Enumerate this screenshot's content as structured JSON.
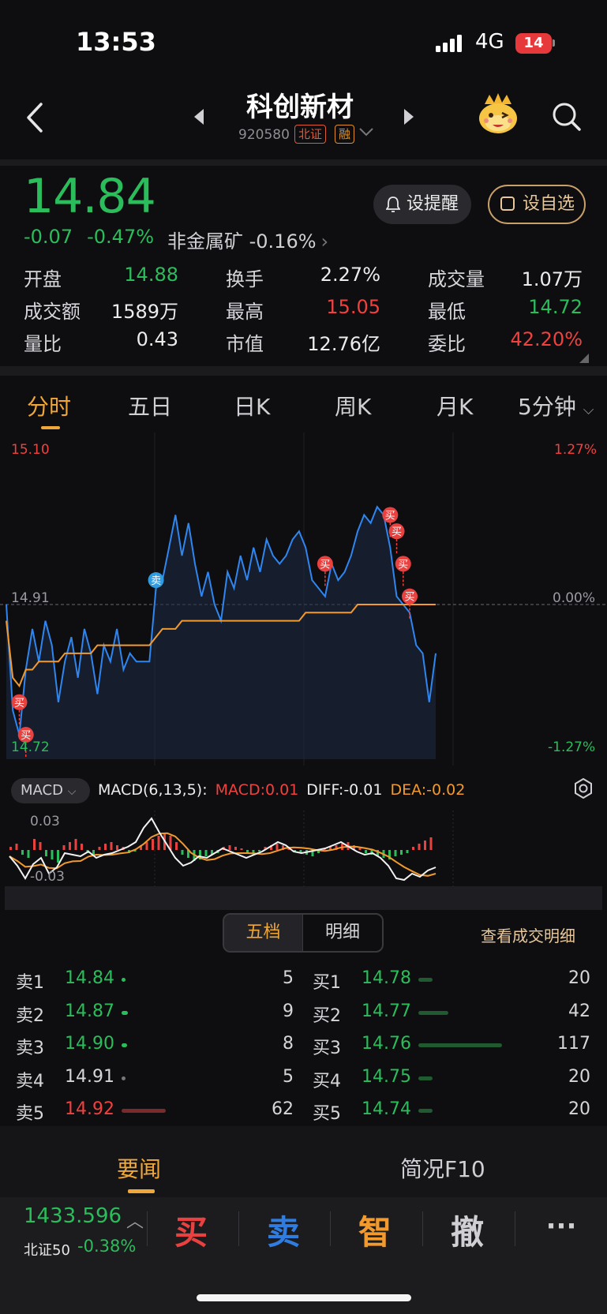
{
  "status": {
    "time": "13:53",
    "network": "4G",
    "battery": "14"
  },
  "header": {
    "name": "科创新材",
    "code": "920580",
    "tag_exchange": "北证",
    "tag_margin": "融"
  },
  "quote": {
    "price": "14.84",
    "change": "-0.07",
    "change_pct": "-0.47%",
    "industry": "非金属矿 -0.16%",
    "alert_label": "设提醒",
    "watch_label": "设自选"
  },
  "stats": [
    {
      "label": "开盘",
      "value": "14.88",
      "color": "#2bbd5b"
    },
    {
      "label": "换手",
      "value": "2.27%",
      "color": "#ececec"
    },
    {
      "label": "成交量",
      "value": "1.07万",
      "color": "#ececec"
    },
    {
      "label": "成交额",
      "value": "1589万",
      "color": "#ececec"
    },
    {
      "label": "最高",
      "value": "15.05",
      "color": "#f0413f"
    },
    {
      "label": "最低",
      "value": "14.72",
      "color": "#2bbd5b"
    },
    {
      "label": "量比",
      "value": "0.43",
      "color": "#ececec"
    },
    {
      "label": "市值",
      "value": "12.76亿",
      "color": "#ececec"
    },
    {
      "label": "委比",
      "value": "42.20%",
      "color": "#f0413f"
    }
  ],
  "tabs": [
    "分时",
    "五日",
    "日K",
    "周K",
    "月K",
    "5分钟"
  ],
  "chart_data": {
    "type": "line",
    "title": "",
    "y_price_labels": {
      "top": "15.10",
      "mid": "14.91",
      "bottom": "14.72"
    },
    "y_pct_labels": {
      "top": "1.27%",
      "mid": "0.00%",
      "bottom": "-1.27%"
    },
    "ylim": [
      14.72,
      15.1
    ],
    "prev_close": 14.91,
    "series": [
      {
        "values": [
          14.91,
          14.78,
          14.75,
          14.83,
          14.88,
          14.84,
          14.89,
          14.86,
          14.79,
          14.84,
          14.87,
          14.82,
          14.88,
          14.85,
          14.8,
          14.86,
          14.84,
          14.88,
          14.83,
          14.85,
          14.84,
          14.84,
          14.84,
          14.93,
          14.94,
          14.98,
          15.02,
          14.97,
          15.01,
          14.96,
          14.92,
          14.95,
          14.91,
          14.89,
          14.95,
          14.93,
          14.97,
          14.94,
          14.98,
          14.95,
          14.99,
          14.97,
          14.96,
          14.97,
          14.99,
          15.0,
          14.98,
          14.94,
          14.93,
          14.92,
          14.96,
          14.94,
          14.95,
          14.97,
          15.0,
          15.02,
          15.01,
          15.03,
          15.02,
          14.98,
          14.92,
          14.91,
          14.9,
          14.86,
          14.85,
          14.79,
          14.85
        ]
      },
      {
        "values": [
          14.89,
          14.82,
          14.81,
          14.83,
          14.83,
          14.84,
          14.84,
          14.84,
          14.84,
          14.85,
          14.85,
          14.85,
          14.85,
          14.85,
          14.86,
          14.86,
          14.86,
          14.86,
          14.86,
          14.86,
          14.86,
          14.86,
          14.86,
          14.87,
          14.88,
          14.88,
          14.88,
          14.89,
          14.89,
          14.89,
          14.89,
          14.89,
          14.89,
          14.89,
          14.89,
          14.89,
          14.89,
          14.89,
          14.89,
          14.89,
          14.89,
          14.89,
          14.89,
          14.89,
          14.89,
          14.89,
          14.9,
          14.9,
          14.9,
          14.9,
          14.9,
          14.9,
          14.9,
          14.9,
          14.91,
          14.91,
          14.91,
          14.91,
          14.91,
          14.91,
          14.91,
          14.91,
          14.91,
          14.91,
          14.91,
          14.91,
          14.91
        ]
      }
    ],
    "markers": [
      {
        "label": "买",
        "i": 2,
        "v": 14.79
      },
      {
        "label": "买",
        "i": 3,
        "v": 14.75
      },
      {
        "label": "卖",
        "i": 23,
        "v": 14.94
      },
      {
        "label": "买",
        "i": 49,
        "v": 14.96
      },
      {
        "label": "买",
        "i": 59,
        "v": 15.02
      },
      {
        "label": "买",
        "i": 60,
        "v": 15.0
      },
      {
        "label": "买",
        "i": 61,
        "v": 14.96
      },
      {
        "label": "买",
        "i": 62,
        "v": 14.92
      }
    ]
  },
  "macd": {
    "selector": "MACD",
    "params": "MACD(6,13,5):",
    "macd": "MACD:0.01",
    "diff": "DIFF:-0.01",
    "dea": "DEA:-0.02",
    "label_top": "0.03",
    "label_bottom": "-0.03"
  },
  "orderbook": {
    "toggle": [
      "五档",
      "明细"
    ],
    "view_detail": "查看成交明细",
    "sell": [
      {
        "label": "卖1",
        "price": "14.84",
        "vol": "5",
        "pcolor": "#2bbd5b"
      },
      {
        "label": "卖2",
        "price": "14.87",
        "vol": "9",
        "pcolor": "#2bbd5b"
      },
      {
        "label": "卖3",
        "price": "14.90",
        "vol": "8",
        "pcolor": "#2bbd5b"
      },
      {
        "label": "卖4",
        "price": "14.91",
        "vol": "5",
        "pcolor": "#d6d6da"
      },
      {
        "label": "卖5",
        "price": "14.92",
        "vol": "62",
        "pcolor": "#f0413f"
      }
    ],
    "buy": [
      {
        "label": "买1",
        "price": "14.78",
        "vol": "20",
        "pcolor": "#2bbd5b"
      },
      {
        "label": "买2",
        "price": "14.77",
        "vol": "42",
        "pcolor": "#2bbd5b"
      },
      {
        "label": "买3",
        "price": "14.76",
        "vol": "117",
        "pcolor": "#2bbd5b"
      },
      {
        "label": "买4",
        "price": "14.75",
        "vol": "20",
        "pcolor": "#2bbd5b"
      },
      {
        "label": "买5",
        "price": "14.74",
        "vol": "20",
        "pcolor": "#2bbd5b"
      }
    ]
  },
  "bottom_tabs": [
    "要闻",
    "简况F10"
  ],
  "index": {
    "value": "1433.596",
    "name": "北证50",
    "change": "-0.38%"
  },
  "actions": [
    {
      "label": "买",
      "color": "#e8413f"
    },
    {
      "label": "卖",
      "color": "#2f7de0"
    },
    {
      "label": "智",
      "color": "#f29a2e"
    },
    {
      "label": "撤",
      "color": "#cfcfd4"
    },
    {
      "label": "···",
      "color": "#cfcfd4"
    }
  ]
}
